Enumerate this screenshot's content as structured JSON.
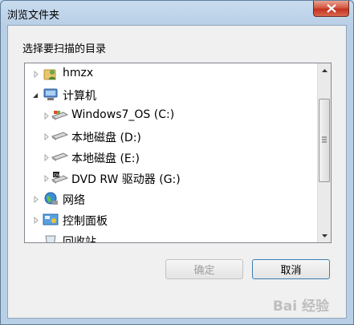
{
  "window": {
    "title": "浏览文件夹"
  },
  "dialog": {
    "description": "选择要扫描的目录"
  },
  "tree": {
    "items": [
      {
        "label": "hmzx",
        "icon": "user-folder-icon",
        "toggle": "collapsed"
      },
      {
        "label": "计算机",
        "icon": "computer-icon",
        "toggle": "expanded"
      },
      {
        "label": "Windows7_OS (C:)",
        "icon": "system-drive-icon",
        "toggle": "collapsed"
      },
      {
        "label": "本地磁盘 (D:)",
        "icon": "hard-drive-icon",
        "toggle": "collapsed"
      },
      {
        "label": "本地磁盘 (E:)",
        "icon": "hard-drive-icon",
        "toggle": "collapsed"
      },
      {
        "label": "DVD RW 驱动器 (G:)",
        "icon": "dvd-drive-icon",
        "toggle": "collapsed"
      },
      {
        "label": "网络",
        "icon": "network-icon",
        "toggle": "collapsed"
      },
      {
        "label": "控制面板",
        "icon": "control-panel-icon",
        "toggle": "collapsed"
      },
      {
        "label": "回收站",
        "icon": "recycle-bin-icon",
        "toggle": "none"
      }
    ]
  },
  "buttons": {
    "ok": "确定",
    "cancel": "取消"
  },
  "watermark": "Bai 经验",
  "colors": {
    "title_bar": "#b9cfe6",
    "close_button": "#c3321f",
    "selection_none": "#ffffff"
  }
}
